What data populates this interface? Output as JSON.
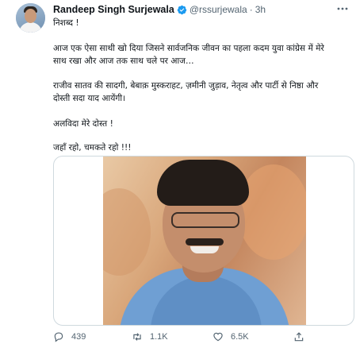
{
  "tweet": {
    "author": {
      "name": "Randeep Singh Surjewala",
      "handle": "@rssurjewala",
      "separator": "·",
      "time": "3h",
      "verified": true,
      "avatar_icon": "user-avatar"
    },
    "paragraphs": [
      "निशब्द !",
      "आज एक ऐसा साथी खो दिया जिसने सार्वजनिक जीवन का पहला कदम युवा कांग्रेस में मेरे\nसाथ रखा और आज तक साथ चले पर आज…",
      "राजीव सातव की सादगी, बेबाक़ मुस्कराहट, ज़मीनी जुड़ाव, नेतृत्व और पार्टी से निष्ठा और\nदोस्ती सदा याद आयेंगी।",
      "अलविदा मेरे दोस्त !",
      "जहाँ रहो, चमकते रहो !!!"
    ],
    "media": {
      "type": "photo"
    },
    "actions": {
      "reply_count": "439",
      "retweet_count": "1.1K",
      "like_count": "6.5K"
    }
  },
  "colors": {
    "verified": "#1d9bf0",
    "secondary_text": "#536471",
    "primary_text": "#0f1419",
    "border": "#cfd9de"
  }
}
